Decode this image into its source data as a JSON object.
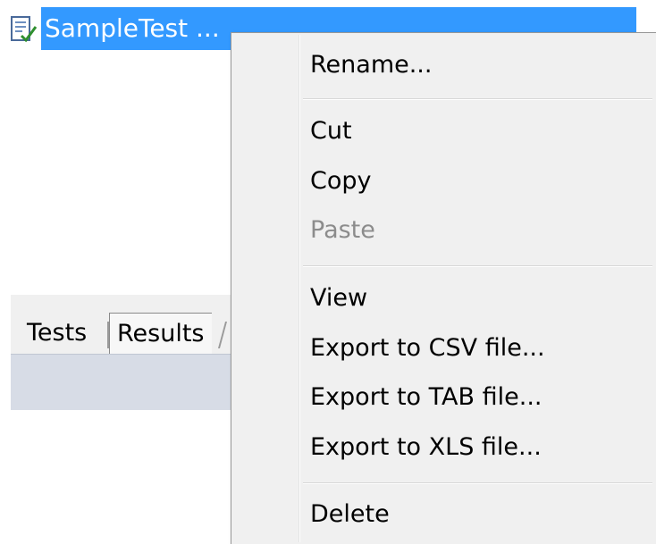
{
  "tree": {
    "item_label": "SampleTest ...",
    "item_icon": "test-file-icon",
    "selection_color": "#3399ff"
  },
  "tabs": [
    {
      "label": "Tests"
    },
    {
      "label": "Results"
    }
  ],
  "context_menu": {
    "items": [
      {
        "label": "Rename...",
        "enabled": true
      },
      {
        "label": "Cut",
        "enabled": true
      },
      {
        "label": "Copy",
        "enabled": true
      },
      {
        "label": "Paste",
        "enabled": false
      },
      {
        "label": "View",
        "enabled": true
      },
      {
        "label": "Export to CSV file...",
        "enabled": true
      },
      {
        "label": "Export to TAB file...",
        "enabled": true
      },
      {
        "label": "Export to XLS file...",
        "enabled": true
      },
      {
        "label": "Delete",
        "enabled": true
      }
    ]
  }
}
